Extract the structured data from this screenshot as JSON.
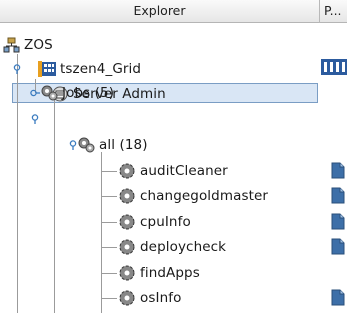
{
  "header": {
    "explorer_label": "Explorer",
    "p_label": "P..."
  },
  "tree": {
    "root": {
      "label": "ZOS",
      "icon": "org-chart-icon"
    },
    "grid": {
      "label": "tszen4_Grid",
      "icon": "grid-server-icon"
    },
    "server_admin": {
      "label": "Server Admin",
      "icon": "server-admin-icon"
    },
    "jobs": {
      "label": "Jobs (5)",
      "icon": "gears-icon",
      "selected": true
    },
    "all": {
      "label": "all (18)",
      "icon": "gears-icon"
    },
    "items": [
      {
        "label": "auditCleaner",
        "icon": "gear-icon",
        "has_doc": true
      },
      {
        "label": "changegoldmaster",
        "icon": "gear-icon",
        "has_doc": true
      },
      {
        "label": "cpuInfo",
        "icon": "gear-icon",
        "has_doc": true
      },
      {
        "label": "deploycheck",
        "icon": "gear-icon",
        "has_doc": true
      },
      {
        "label": "findApps",
        "icon": "gear-icon",
        "has_doc": false
      },
      {
        "label": "osInfo",
        "icon": "gear-icon",
        "has_doc": true
      }
    ]
  },
  "colors": {
    "selection_bg": "#d9e6f5",
    "selection_border": "#7a9dc4",
    "doc_blue": "#3d6fa8",
    "tree_line": "#9b9b9b",
    "toggle_blue": "#3a7bbf"
  }
}
